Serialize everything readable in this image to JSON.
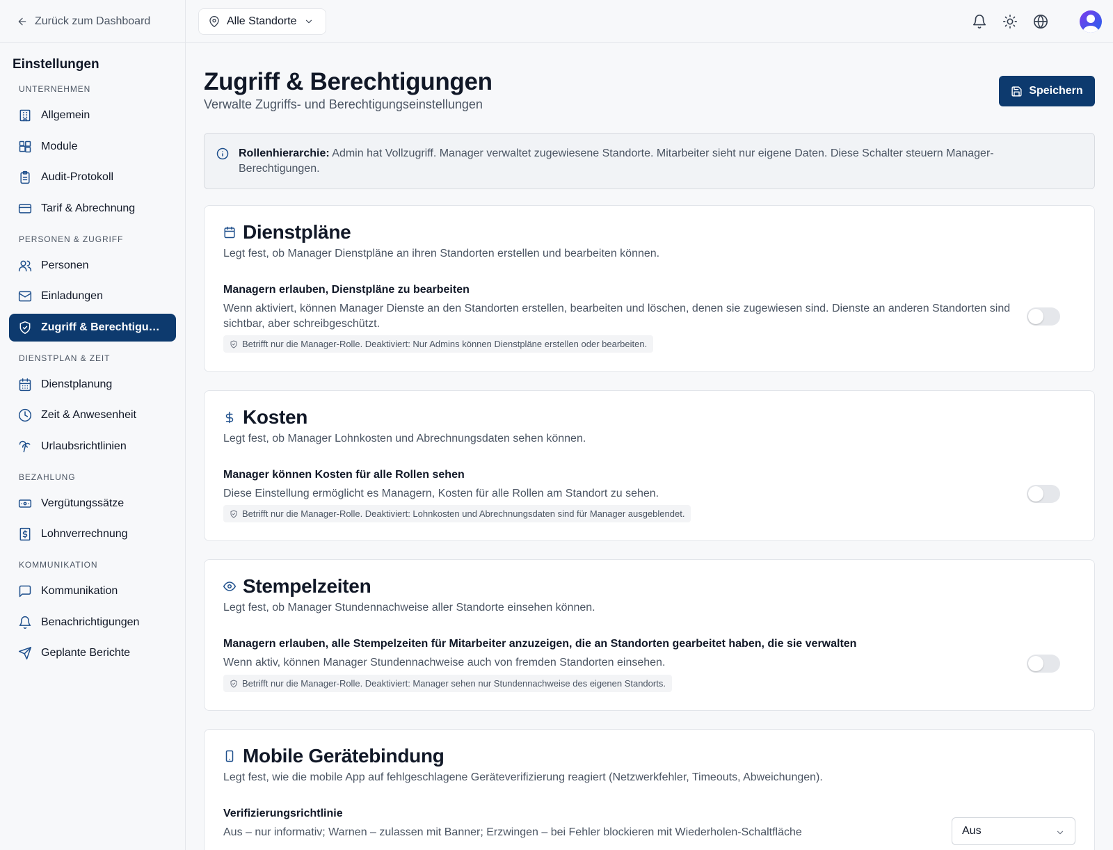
{
  "sidebar": {
    "back_label": "Zurück zum Dashboard",
    "title": "Einstellungen",
    "sections": [
      {
        "label": "UNTERNEHMEN",
        "items": [
          {
            "label": "Allgemein",
            "icon": "building-icon"
          },
          {
            "label": "Module",
            "icon": "modules-icon"
          },
          {
            "label": "Audit-Protokoll",
            "icon": "clipboard-icon"
          },
          {
            "label": "Tarif & Abrechnung",
            "icon": "credit-card-icon"
          }
        ]
      },
      {
        "label": "PERSONEN & ZUGRIFF",
        "items": [
          {
            "label": "Personen",
            "icon": "users-icon"
          },
          {
            "label": "Einladungen",
            "icon": "mail-icon"
          },
          {
            "label": "Zugriff & Berechtigungen",
            "icon": "shield-check-icon",
            "active": true
          }
        ]
      },
      {
        "label": "DIENSTPLAN & ZEIT",
        "items": [
          {
            "label": "Dienstplanung",
            "icon": "calendar-icon"
          },
          {
            "label": "Zeit & Anwesenheit",
            "icon": "clock-icon"
          },
          {
            "label": "Urlaubsrichtlinien",
            "icon": "palm-tree-icon"
          }
        ]
      },
      {
        "label": "BEZAHLUNG",
        "items": [
          {
            "label": "Vergütungssätze",
            "icon": "banknote-icon"
          },
          {
            "label": "Lohnverrechnung",
            "icon": "receipt-dollar-icon"
          }
        ]
      },
      {
        "label": "KOMMUNIKATION",
        "items": [
          {
            "label": "Kommunikation",
            "icon": "message-square-icon"
          },
          {
            "label": "Benachrichtigungen",
            "icon": "bell-icon"
          },
          {
            "label": "Geplante Berichte",
            "icon": "send-icon"
          }
        ]
      }
    ]
  },
  "topbar": {
    "location_label": "Alle Standorte",
    "icons": [
      "bell-icon",
      "sun-icon",
      "globe-icon",
      "avatar"
    ]
  },
  "page": {
    "title": "Zugriff & Berechtigungen",
    "subtitle": "Verwalte Zugriffs- und Berechtigungseinstellungen",
    "save_label": "Speichern",
    "info_label": "Rollenhierarchie:",
    "info_text": " Admin hat Vollzugriff. Manager verwaltet zugewiesene Standorte. Mitarbeiter sieht nur eigene Daten. Diese Schalter steuern Manager-Berechtigungen."
  },
  "cards": [
    {
      "icon": "calendar-icon",
      "title": "Dienstpläne",
      "desc": "Legt fest, ob Manager Dienstpläne an ihren Standorten erstellen und bearbeiten können.",
      "setting_title": "Managern erlauben, Dienstpläne zu bearbeiten",
      "setting_desc": "Wenn aktiviert, können Manager Dienste an den Standorten erstellen, bearbeiten und löschen, denen sie zugewiesen sind. Dienste an anderen Standorten sind sichtbar, aber schreibgeschützt.",
      "note": "Betrifft nur die Manager-Rolle. Deaktiviert: Nur Admins können Dienstpläne erstellen oder bearbeiten.",
      "enabled": false
    },
    {
      "icon": "dollar-icon",
      "title": "Kosten",
      "desc": "Legt fest, ob Manager Lohnkosten und Abrechnungsdaten sehen können.",
      "setting_title": "Manager können Kosten für alle Rollen sehen",
      "setting_desc": "Diese Einstellung ermöglicht es Managern, Kosten für alle Rollen am Standort zu sehen.",
      "note": "Betrifft nur die Manager-Rolle. Deaktiviert: Lohnkosten und Abrechnungsdaten sind für Manager ausgeblendet.",
      "enabled": false
    },
    {
      "icon": "eye-icon",
      "title": "Stempelzeiten",
      "desc": "Legt fest, ob Manager Stundennachweise aller Standorte einsehen können.",
      "setting_title": "Managern erlauben, alle Stempelzeiten für Mitarbeiter anzuzeigen, die an Standorten gearbeitet haben, die sie verwalten",
      "setting_desc": "Wenn aktiv, können Manager Stundennachweise auch von fremden Standorten einsehen.",
      "note": "Betrifft nur die Manager-Rolle. Deaktiviert: Manager sehen nur Stundennachweise des eigenen Standorts.",
      "enabled": false
    },
    {
      "icon": "smartphone-icon",
      "title": "Mobile Gerätebindung",
      "desc": "Legt fest, wie die mobile App auf fehlgeschlagene Geräteverifizierung reagiert (Netzwerkfehler, Timeouts, Abweichungen).",
      "setting_title": "Verifizierungsrichtlinie",
      "setting_desc": "Aus – nur informativ; Warnen – zulassen mit Banner; Erzwingen – bei Fehler blockieren mit Wiederholen-Schaltfläche",
      "select_value": "Aus"
    }
  ]
}
